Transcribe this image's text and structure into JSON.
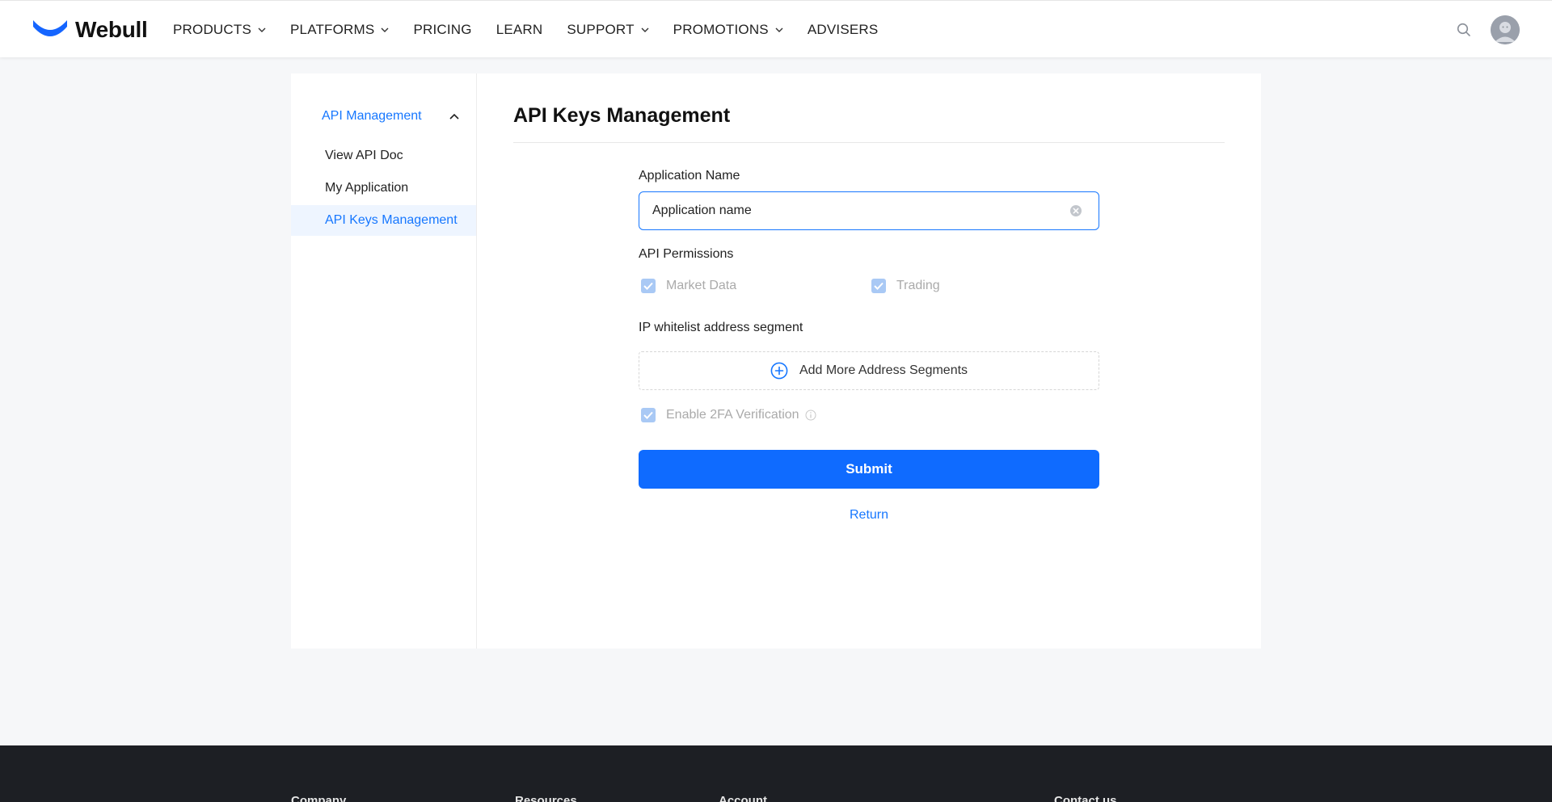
{
  "header": {
    "logo_text": "Webull",
    "nav": [
      {
        "label": "PRODUCTS",
        "dropdown": true
      },
      {
        "label": "PLATFORMS",
        "dropdown": true
      },
      {
        "label": "PRICING",
        "dropdown": false
      },
      {
        "label": "LEARN",
        "dropdown": false
      },
      {
        "label": "SUPPORT",
        "dropdown": true
      },
      {
        "label": "PROMOTIONS",
        "dropdown": true
      },
      {
        "label": "ADVISERS",
        "dropdown": false
      }
    ]
  },
  "sidebar": {
    "group_label": "API Management",
    "items": [
      {
        "label": "View API Doc",
        "active": false
      },
      {
        "label": "My Application",
        "active": false
      },
      {
        "label": "API Keys Management",
        "active": true
      }
    ]
  },
  "main": {
    "title": "API Keys Management",
    "application_name": {
      "label": "Application Name",
      "value": "Application name"
    },
    "permissions": {
      "label": "API Permissions",
      "options": [
        {
          "label": "Market Data",
          "checked": true
        },
        {
          "label": "Trading",
          "checked": true
        }
      ]
    },
    "ip_whitelist": {
      "label": "IP whitelist address segment",
      "add_label": "Add More Address Segments"
    },
    "twofa": {
      "label": "Enable 2FA Verification",
      "checked": true
    },
    "submit_label": "Submit",
    "return_label": "Return"
  },
  "footer": {
    "columns": [
      "Company",
      "Resources",
      "Account",
      "Contact us"
    ]
  },
  "colors": {
    "accent": "#1677ff",
    "submit_bg": "#0f6bff",
    "footer_bg": "#1d1f24",
    "checkbox_disabled": "#a9c9f5"
  },
  "icons": {
    "search": "search-icon",
    "clear": "clear-circle-icon",
    "add": "plus-circle-icon",
    "info": "info-icon"
  }
}
